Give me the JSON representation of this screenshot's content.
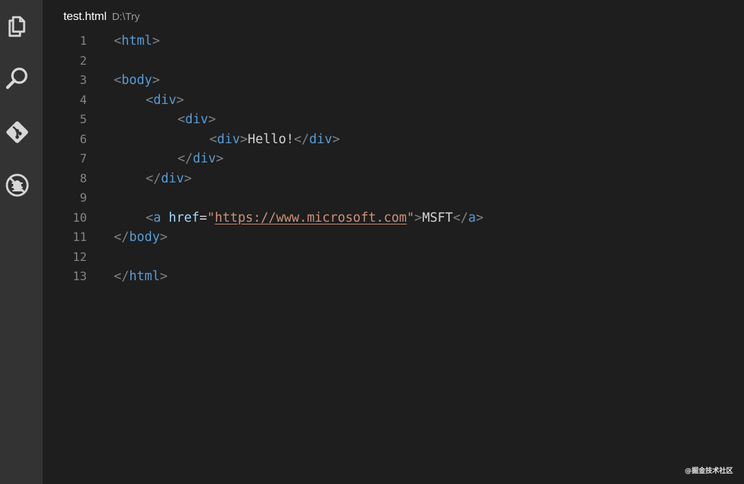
{
  "activity_bar": {
    "icons": [
      "files-icon",
      "search-icon",
      "source-control-icon",
      "debug-icon"
    ]
  },
  "tab": {
    "file_name": "test.html",
    "file_path": "D:\\Try"
  },
  "lines": [
    {
      "num": "1",
      "p1": "<",
      "tag": "html",
      "p2": ">"
    },
    {
      "num": "2"
    },
    {
      "num": "3",
      "p1": "<",
      "tag": "body",
      "p2": ">"
    },
    {
      "num": "4",
      "p1": "<",
      "tag": "div",
      "p2": ">"
    },
    {
      "num": "5",
      "p1": "<",
      "tag": "div",
      "p2": ">"
    },
    {
      "num": "6",
      "p1": "<",
      "tag": "div",
      "p2": ">",
      "text": "Hello!",
      "p3": "</",
      "tag2": "div",
      "p4": ">"
    },
    {
      "num": "7",
      "p1": "</",
      "tag": "div",
      "p2": ">"
    },
    {
      "num": "8",
      "p1": "</",
      "tag": "div",
      "p2": ">"
    },
    {
      "num": "9"
    },
    {
      "num": "10",
      "p1": "<",
      "tag": "a",
      "attr": "href",
      "eq": "=",
      "q1": "\"",
      "url": "https://www.microsoft.com",
      "q2": "\"",
      "p2": ">",
      "text": "MSFT",
      "p3": "</",
      "tag2": "a",
      "p4": ">"
    },
    {
      "num": "11",
      "p1": "</",
      "tag": "body",
      "p2": ">"
    },
    {
      "num": "12"
    },
    {
      "num": "13",
      "p1": "</",
      "tag": "html",
      "p2": ">"
    }
  ],
  "watermark": "@掘金技术社区",
  "colors": {
    "background": "#1e1e1e",
    "activity_bar": "#333333",
    "tag": "#569cd6",
    "punctuation": "#808080",
    "attribute": "#9cdcfe",
    "string": "#ce9178",
    "text": "#d4d4d4",
    "line_number": "#858585"
  }
}
